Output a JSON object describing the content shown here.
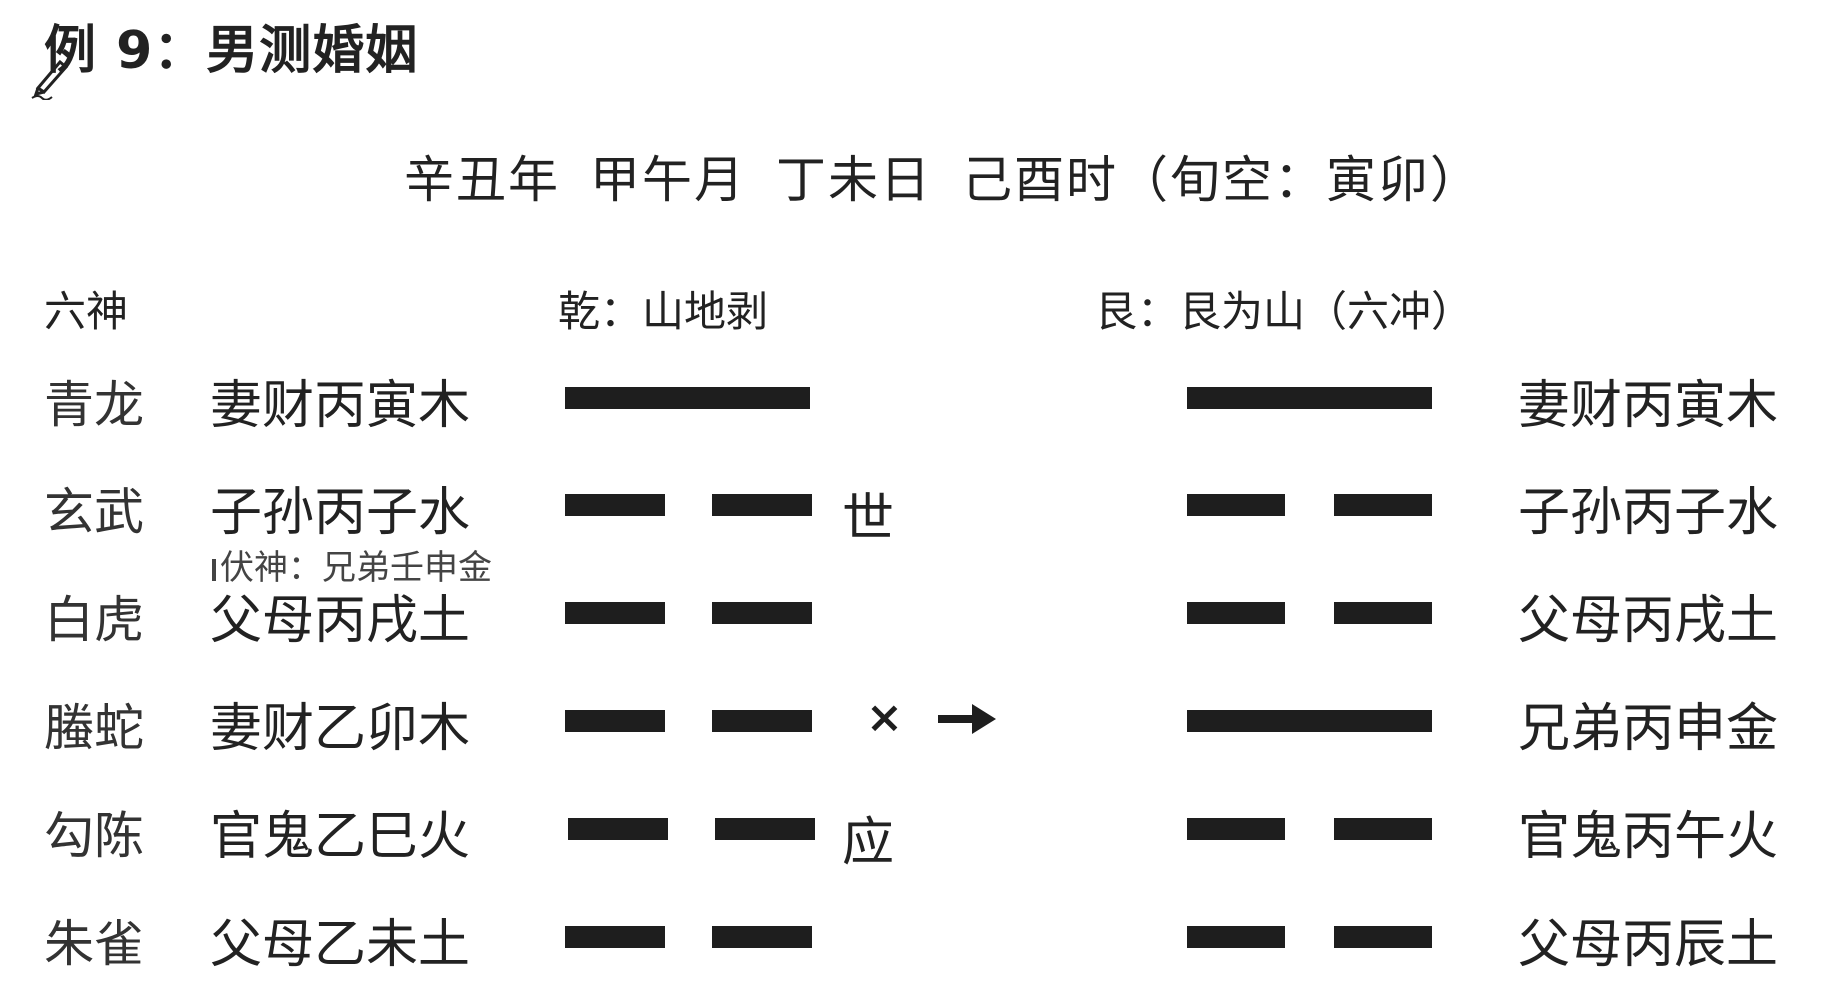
{
  "title": "例 9：男测婚姻",
  "date": {
    "year": "辛丑年",
    "month": "甲午月",
    "day": "丁未日",
    "hour": "己酉时",
    "xunkong": "（旬空：寅卯）"
  },
  "headers": {
    "liushen": "六神",
    "main_hexagram": "乾：山地剥",
    "changed_hexagram": "艮：艮为山（六冲）"
  },
  "rows": [
    {
      "god": "青龙",
      "main": "妻财丙寅木",
      "main_type": "yang",
      "changed": "妻财丙寅木",
      "changed_type": "yang"
    },
    {
      "god": "玄武",
      "main": "子孙丙子水",
      "main_type": "yin",
      "changed": "子孙丙子水",
      "changed_type": "yin",
      "marker": "世"
    },
    {
      "god": "白虎",
      "main": "父母丙戌土",
      "main_type": "yin",
      "changed": "父母丙戌土",
      "changed_type": "yin"
    },
    {
      "god": "螣蛇",
      "main": "妻财乙卯木",
      "main_type": "yin",
      "changed": "兄弟丙申金",
      "changed_type": "yang",
      "moving": "×"
    },
    {
      "god": "勾陈",
      "main": "官鬼乙巳火",
      "main_type": "yin",
      "changed": "官鬼丙午火",
      "changed_type": "yin",
      "marker": "应"
    },
    {
      "god": "朱雀",
      "main": "父母乙未土",
      "main_type": "yin",
      "changed": "父母丙辰土",
      "changed_type": "yin"
    }
  ],
  "fushen": "伏神：兄弟壬申金",
  "icons": {
    "pen": "pen-icon",
    "arrow": "arrow-right-icon"
  },
  "colors": {
    "ink": "#1e1e1e",
    "background": "#ffffff"
  }
}
